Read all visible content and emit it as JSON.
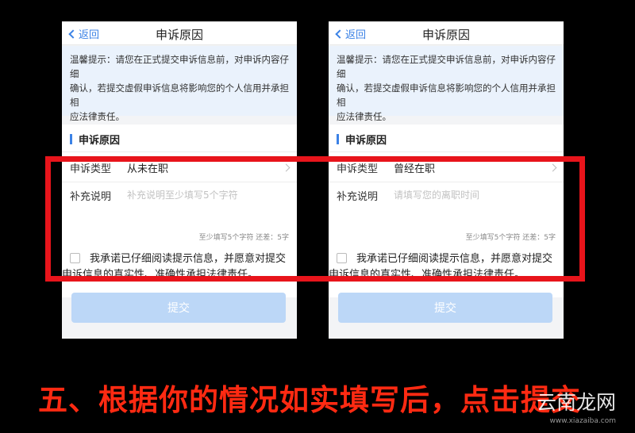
{
  "screens": [
    {
      "nav": {
        "back_label": "返回",
        "title": "申诉原因"
      },
      "tip": {
        "line1": "温馨提示：请您在正式提交申诉信息前，对申诉内容仔细",
        "line2": "确认，若提交虚假申诉信息将影响您的个人信用并承担相",
        "line3": "应法律责任。"
      },
      "section_title": "申诉原因",
      "appeal_type_label": "申诉类型",
      "appeal_type_value": "从未在职",
      "note_label": "补充说明",
      "note_placeholder": "补充说明至少填写5个字符",
      "counter": "至少填写5个字符 还差：5字",
      "agree_line1": "我承诺已仔细阅读提示信息，并愿意对提交",
      "agree_line2": "申诉信息的真实性、准确性承担法律责任。",
      "submit_label": "提交"
    },
    {
      "nav": {
        "back_label": "返回",
        "title": "申诉原因"
      },
      "tip": {
        "line1": "温馨提示：请您在正式提交申诉信息前，对申诉内容仔细",
        "line2": "确认，若提交虚假申诉信息将影响您的个人信用并承担相",
        "line3": "应法律责任。"
      },
      "section_title": "申诉原因",
      "appeal_type_label": "申诉类型",
      "appeal_type_value": "曾经在职",
      "note_label": "补充说明",
      "note_placeholder": "请填写您的离职时间",
      "counter": "至少填写5个字符 还差：5字",
      "agree_line1": "我承诺已仔细阅读提示信息，并愿意对提交",
      "agree_line2": "申诉信息的真实性、准确性承担法律责任。",
      "submit_label": "提交"
    }
  ],
  "caption": "五、根据你的情况如实填写后，点击提交",
  "watermark": {
    "brand": "云南龙网",
    "site": "www.xiazaiba.com"
  },
  "colors": {
    "accent": "#3b82e6",
    "highlight": "#e8141b",
    "caption": "#ff2a12",
    "submit_disabled": "#bcd7f7"
  }
}
